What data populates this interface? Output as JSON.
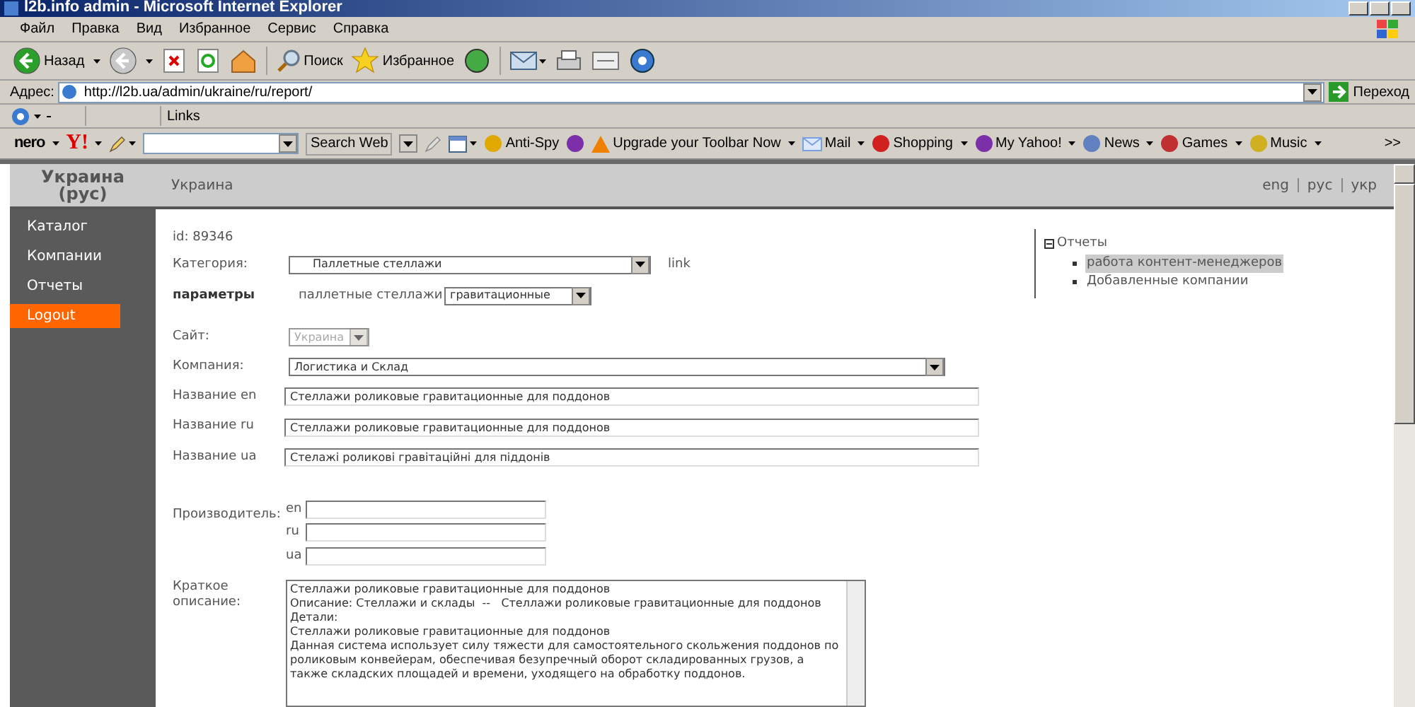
{
  "window": {
    "title": "l2b.info admin - Microsoft Internet Explorer"
  },
  "menu": [
    "Файл",
    "Правка",
    "Вид",
    "Избранное",
    "Сервис",
    "Справка"
  ],
  "toolbar": {
    "back": "Назад",
    "search": "Поиск",
    "favorites": "Избранное"
  },
  "address": {
    "label": "Адрес:",
    "value": "http://l2b.ua/admin/ukraine/ru/report/",
    "go": "Переход"
  },
  "links_bar": {
    "label": "Links"
  },
  "yahoo_toolbar": {
    "logo_nero": "nero",
    "logo_yahoo": "Y!",
    "search_button": "Search Web",
    "items": [
      {
        "label": "Anti-Spy",
        "kind": "antispy"
      },
      {
        "label": "Upgrade your Toolbar Now",
        "kind": "warning"
      },
      {
        "label": "Mail",
        "kind": "mail"
      },
      {
        "label": "Shopping",
        "kind": "shopping"
      },
      {
        "label": "My Yahoo!",
        "kind": "myyahoo"
      },
      {
        "label": "News",
        "kind": "news"
      },
      {
        "label": "Games",
        "kind": "games"
      },
      {
        "label": "Music",
        "kind": "music"
      }
    ],
    "more": ">>"
  },
  "header": {
    "title": "Украина (рус)",
    "breadcrumb": "Украина",
    "languages": [
      "eng",
      "рус",
      "укр"
    ]
  },
  "sidebar": [
    {
      "label": "Каталог",
      "selected": false
    },
    {
      "label": "Компании",
      "selected": false
    },
    {
      "label": "Отчеты",
      "selected": false
    },
    {
      "label": "Logout",
      "selected": true
    }
  ],
  "form": {
    "id_text": "id: 89346",
    "category": {
      "label": "Категория:",
      "value": "Паллетные стеллажи",
      "link": "link"
    },
    "params": {
      "label": "параметры",
      "name": "паллетные стеллажи",
      "value": "гравитационные"
    },
    "site": {
      "label": "Сайт:",
      "value": "Украина",
      "disabled": true
    },
    "company": {
      "label": "Компания:",
      "value": "Логистика и Склад"
    },
    "names": [
      {
        "label": "Название en",
        "value": "Стеллажи роликовые гравитационные для поддонов"
      },
      {
        "label": "Название ru",
        "value": "Стеллажи роликовые гравитационные для поддонов"
      },
      {
        "label": "Название ua",
        "value": "Стелажі роликові гравітаційні для піддонів"
      }
    ],
    "manufacturer": {
      "label": "Производитель:",
      "fields": [
        {
          "lang": "en"
        },
        {
          "lang": "ru"
        },
        {
          "lang": "ua"
        }
      ]
    },
    "short_description": {
      "label": "Краткое описание:",
      "lines": [
        "Стеллажи роликовые гравитационные для поддонов",
        "Описание: Стеллажи и склады  --   Стеллажи роликовые гравитационные для поддонов",
        "Детали:",
        "Стеллажи роликовые гравитационные для поддонов",
        "Данная система использует силу тяжести для самостоятельного скольжения поддонов по",
        "роликовым конвейерам, обеспечивая безупречный оборот складированных грузов, а",
        "также складских площадей и времени, уходящего на обработку поддонов."
      ]
    }
  },
  "tree": {
    "title": "Отчеты",
    "expanded": true,
    "children": [
      {
        "label": "работа контент-менеджеров",
        "selected": true
      },
      {
        "label": "Добавленные компании",
        "selected": false
      }
    ]
  }
}
